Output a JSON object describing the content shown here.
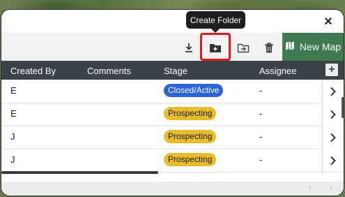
{
  "tooltip": "Create Folder",
  "close_icon": "×",
  "toolbar": {
    "new_map_label": "New Map",
    "icons": [
      "download-icon",
      "create-folder-icon",
      "move-to-folder-icon",
      "delete-icon",
      "map-icon"
    ]
  },
  "table": {
    "headers": [
      "Created By",
      "Comments",
      "Stage",
      "Assignee"
    ],
    "add_column": "+",
    "rows": [
      {
        "created_by": "E",
        "stage": "Closed/Active",
        "stage_color": "#2d63d8",
        "assignee": "-"
      },
      {
        "created_by": "E",
        "stage": "Prospecting",
        "stage_color": "#e7bd2c",
        "assignee": "-"
      },
      {
        "created_by": "J",
        "stage": "Prospecting",
        "stage_color": "#e7bd2c",
        "assignee": "-"
      },
      {
        "created_by": "J",
        "stage": "Prospecting",
        "stage_color": "#e7bd2c",
        "assignee": "-"
      }
    ]
  },
  "colors": {
    "header_bg": "#3b4248",
    "new_map_bg": "#3f7a52",
    "highlight": "#e0191f"
  }
}
